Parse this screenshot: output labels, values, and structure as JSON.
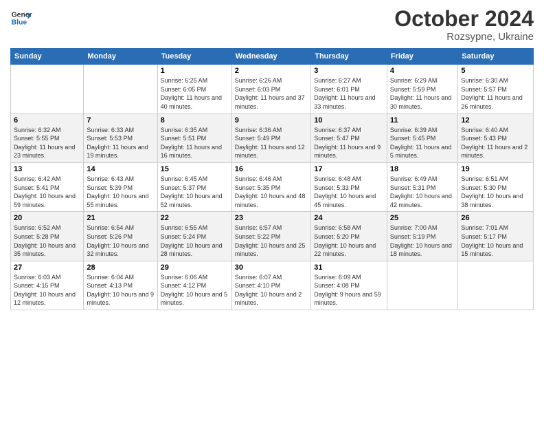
{
  "header": {
    "logo_line1": "General",
    "logo_line2": "Blue",
    "title": "October 2024",
    "location": "Rozsypne, Ukraine"
  },
  "columns": [
    "Sunday",
    "Monday",
    "Tuesday",
    "Wednesday",
    "Thursday",
    "Friday",
    "Saturday"
  ],
  "weeks": [
    [
      {
        "day": "",
        "sunrise": "",
        "sunset": "",
        "daylight": ""
      },
      {
        "day": "",
        "sunrise": "",
        "sunset": "",
        "daylight": ""
      },
      {
        "day": "1",
        "sunrise": "Sunrise: 6:25 AM",
        "sunset": "Sunset: 6:05 PM",
        "daylight": "Daylight: 11 hours and 40 minutes."
      },
      {
        "day": "2",
        "sunrise": "Sunrise: 6:26 AM",
        "sunset": "Sunset: 6:03 PM",
        "daylight": "Daylight: 11 hours and 37 minutes."
      },
      {
        "day": "3",
        "sunrise": "Sunrise: 6:27 AM",
        "sunset": "Sunset: 6:01 PM",
        "daylight": "Daylight: 11 hours and 33 minutes."
      },
      {
        "day": "4",
        "sunrise": "Sunrise: 6:29 AM",
        "sunset": "Sunset: 5:59 PM",
        "daylight": "Daylight: 11 hours and 30 minutes."
      },
      {
        "day": "5",
        "sunrise": "Sunrise: 6:30 AM",
        "sunset": "Sunset: 5:57 PM",
        "daylight": "Daylight: 11 hours and 26 minutes."
      }
    ],
    [
      {
        "day": "6",
        "sunrise": "Sunrise: 6:32 AM",
        "sunset": "Sunset: 5:55 PM",
        "daylight": "Daylight: 11 hours and 23 minutes."
      },
      {
        "day": "7",
        "sunrise": "Sunrise: 6:33 AM",
        "sunset": "Sunset: 5:53 PM",
        "daylight": "Daylight: 11 hours and 19 minutes."
      },
      {
        "day": "8",
        "sunrise": "Sunrise: 6:35 AM",
        "sunset": "Sunset: 5:51 PM",
        "daylight": "Daylight: 11 hours and 16 minutes."
      },
      {
        "day": "9",
        "sunrise": "Sunrise: 6:36 AM",
        "sunset": "Sunset: 5:49 PM",
        "daylight": "Daylight: 11 hours and 12 minutes."
      },
      {
        "day": "10",
        "sunrise": "Sunrise: 6:37 AM",
        "sunset": "Sunset: 5:47 PM",
        "daylight": "Daylight: 11 hours and 9 minutes."
      },
      {
        "day": "11",
        "sunrise": "Sunrise: 6:39 AM",
        "sunset": "Sunset: 5:45 PM",
        "daylight": "Daylight: 11 hours and 5 minutes."
      },
      {
        "day": "12",
        "sunrise": "Sunrise: 6:40 AM",
        "sunset": "Sunset: 5:43 PM",
        "daylight": "Daylight: 11 hours and 2 minutes."
      }
    ],
    [
      {
        "day": "13",
        "sunrise": "Sunrise: 6:42 AM",
        "sunset": "Sunset: 5:41 PM",
        "daylight": "Daylight: 10 hours and 59 minutes."
      },
      {
        "day": "14",
        "sunrise": "Sunrise: 6:43 AM",
        "sunset": "Sunset: 5:39 PM",
        "daylight": "Daylight: 10 hours and 55 minutes."
      },
      {
        "day": "15",
        "sunrise": "Sunrise: 6:45 AM",
        "sunset": "Sunset: 5:37 PM",
        "daylight": "Daylight: 10 hours and 52 minutes."
      },
      {
        "day": "16",
        "sunrise": "Sunrise: 6:46 AM",
        "sunset": "Sunset: 5:35 PM",
        "daylight": "Daylight: 10 hours and 48 minutes."
      },
      {
        "day": "17",
        "sunrise": "Sunrise: 6:48 AM",
        "sunset": "Sunset: 5:33 PM",
        "daylight": "Daylight: 10 hours and 45 minutes."
      },
      {
        "day": "18",
        "sunrise": "Sunrise: 6:49 AM",
        "sunset": "Sunset: 5:31 PM",
        "daylight": "Daylight: 10 hours and 42 minutes."
      },
      {
        "day": "19",
        "sunrise": "Sunrise: 6:51 AM",
        "sunset": "Sunset: 5:30 PM",
        "daylight": "Daylight: 10 hours and 38 minutes."
      }
    ],
    [
      {
        "day": "20",
        "sunrise": "Sunrise: 6:52 AM",
        "sunset": "Sunset: 5:28 PM",
        "daylight": "Daylight: 10 hours and 35 minutes."
      },
      {
        "day": "21",
        "sunrise": "Sunrise: 6:54 AM",
        "sunset": "Sunset: 5:26 PM",
        "daylight": "Daylight: 10 hours and 32 minutes."
      },
      {
        "day": "22",
        "sunrise": "Sunrise: 6:55 AM",
        "sunset": "Sunset: 5:24 PM",
        "daylight": "Daylight: 10 hours and 28 minutes."
      },
      {
        "day": "23",
        "sunrise": "Sunrise: 6:57 AM",
        "sunset": "Sunset: 5:22 PM",
        "daylight": "Daylight: 10 hours and 25 minutes."
      },
      {
        "day": "24",
        "sunrise": "Sunrise: 6:58 AM",
        "sunset": "Sunset: 5:20 PM",
        "daylight": "Daylight: 10 hours and 22 minutes."
      },
      {
        "day": "25",
        "sunrise": "Sunrise: 7:00 AM",
        "sunset": "Sunset: 5:19 PM",
        "daylight": "Daylight: 10 hours and 18 minutes."
      },
      {
        "day": "26",
        "sunrise": "Sunrise: 7:01 AM",
        "sunset": "Sunset: 5:17 PM",
        "daylight": "Daylight: 10 hours and 15 minutes."
      }
    ],
    [
      {
        "day": "27",
        "sunrise": "Sunrise: 6:03 AM",
        "sunset": "Sunset: 4:15 PM",
        "daylight": "Daylight: 10 hours and 12 minutes."
      },
      {
        "day": "28",
        "sunrise": "Sunrise: 6:04 AM",
        "sunset": "Sunset: 4:13 PM",
        "daylight": "Daylight: 10 hours and 9 minutes."
      },
      {
        "day": "29",
        "sunrise": "Sunrise: 6:06 AM",
        "sunset": "Sunset: 4:12 PM",
        "daylight": "Daylight: 10 hours and 5 minutes."
      },
      {
        "day": "30",
        "sunrise": "Sunrise: 6:07 AM",
        "sunset": "Sunset: 4:10 PM",
        "daylight": "Daylight: 10 hours and 2 minutes."
      },
      {
        "day": "31",
        "sunrise": "Sunrise: 6:09 AM",
        "sunset": "Sunset: 4:08 PM",
        "daylight": "Daylight: 9 hours and 59 minutes."
      },
      {
        "day": "",
        "sunrise": "",
        "sunset": "",
        "daylight": ""
      },
      {
        "day": "",
        "sunrise": "",
        "sunset": "",
        "daylight": ""
      }
    ]
  ]
}
